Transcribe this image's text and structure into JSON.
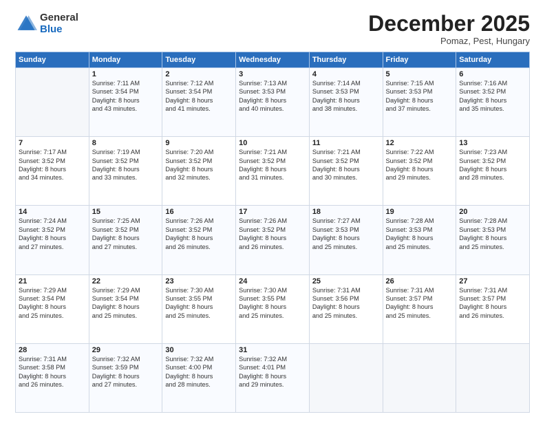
{
  "logo": {
    "general": "General",
    "blue": "Blue"
  },
  "header": {
    "month": "December 2025",
    "location": "Pomaz, Pest, Hungary"
  },
  "days_of_week": [
    "Sunday",
    "Monday",
    "Tuesday",
    "Wednesday",
    "Thursday",
    "Friday",
    "Saturday"
  ],
  "weeks": [
    [
      {
        "day": "",
        "info": ""
      },
      {
        "day": "1",
        "info": "Sunrise: 7:11 AM\nSunset: 3:54 PM\nDaylight: 8 hours\nand 43 minutes."
      },
      {
        "day": "2",
        "info": "Sunrise: 7:12 AM\nSunset: 3:54 PM\nDaylight: 8 hours\nand 41 minutes."
      },
      {
        "day": "3",
        "info": "Sunrise: 7:13 AM\nSunset: 3:53 PM\nDaylight: 8 hours\nand 40 minutes."
      },
      {
        "day": "4",
        "info": "Sunrise: 7:14 AM\nSunset: 3:53 PM\nDaylight: 8 hours\nand 38 minutes."
      },
      {
        "day": "5",
        "info": "Sunrise: 7:15 AM\nSunset: 3:53 PM\nDaylight: 8 hours\nand 37 minutes."
      },
      {
        "day": "6",
        "info": "Sunrise: 7:16 AM\nSunset: 3:52 PM\nDaylight: 8 hours\nand 35 minutes."
      }
    ],
    [
      {
        "day": "7",
        "info": "Sunrise: 7:17 AM\nSunset: 3:52 PM\nDaylight: 8 hours\nand 34 minutes."
      },
      {
        "day": "8",
        "info": "Sunrise: 7:19 AM\nSunset: 3:52 PM\nDaylight: 8 hours\nand 33 minutes."
      },
      {
        "day": "9",
        "info": "Sunrise: 7:20 AM\nSunset: 3:52 PM\nDaylight: 8 hours\nand 32 minutes."
      },
      {
        "day": "10",
        "info": "Sunrise: 7:21 AM\nSunset: 3:52 PM\nDaylight: 8 hours\nand 31 minutes."
      },
      {
        "day": "11",
        "info": "Sunrise: 7:21 AM\nSunset: 3:52 PM\nDaylight: 8 hours\nand 30 minutes."
      },
      {
        "day": "12",
        "info": "Sunrise: 7:22 AM\nSunset: 3:52 PM\nDaylight: 8 hours\nand 29 minutes."
      },
      {
        "day": "13",
        "info": "Sunrise: 7:23 AM\nSunset: 3:52 PM\nDaylight: 8 hours\nand 28 minutes."
      }
    ],
    [
      {
        "day": "14",
        "info": "Sunrise: 7:24 AM\nSunset: 3:52 PM\nDaylight: 8 hours\nand 27 minutes."
      },
      {
        "day": "15",
        "info": "Sunrise: 7:25 AM\nSunset: 3:52 PM\nDaylight: 8 hours\nand 27 minutes."
      },
      {
        "day": "16",
        "info": "Sunrise: 7:26 AM\nSunset: 3:52 PM\nDaylight: 8 hours\nand 26 minutes."
      },
      {
        "day": "17",
        "info": "Sunrise: 7:26 AM\nSunset: 3:52 PM\nDaylight: 8 hours\nand 26 minutes."
      },
      {
        "day": "18",
        "info": "Sunrise: 7:27 AM\nSunset: 3:53 PM\nDaylight: 8 hours\nand 25 minutes."
      },
      {
        "day": "19",
        "info": "Sunrise: 7:28 AM\nSunset: 3:53 PM\nDaylight: 8 hours\nand 25 minutes."
      },
      {
        "day": "20",
        "info": "Sunrise: 7:28 AM\nSunset: 3:53 PM\nDaylight: 8 hours\nand 25 minutes."
      }
    ],
    [
      {
        "day": "21",
        "info": "Sunrise: 7:29 AM\nSunset: 3:54 PM\nDaylight: 8 hours\nand 25 minutes."
      },
      {
        "day": "22",
        "info": "Sunrise: 7:29 AM\nSunset: 3:54 PM\nDaylight: 8 hours\nand 25 minutes."
      },
      {
        "day": "23",
        "info": "Sunrise: 7:30 AM\nSunset: 3:55 PM\nDaylight: 8 hours\nand 25 minutes."
      },
      {
        "day": "24",
        "info": "Sunrise: 7:30 AM\nSunset: 3:55 PM\nDaylight: 8 hours\nand 25 minutes."
      },
      {
        "day": "25",
        "info": "Sunrise: 7:31 AM\nSunset: 3:56 PM\nDaylight: 8 hours\nand 25 minutes."
      },
      {
        "day": "26",
        "info": "Sunrise: 7:31 AM\nSunset: 3:57 PM\nDaylight: 8 hours\nand 25 minutes."
      },
      {
        "day": "27",
        "info": "Sunrise: 7:31 AM\nSunset: 3:57 PM\nDaylight: 8 hours\nand 26 minutes."
      }
    ],
    [
      {
        "day": "28",
        "info": "Sunrise: 7:31 AM\nSunset: 3:58 PM\nDaylight: 8 hours\nand 26 minutes."
      },
      {
        "day": "29",
        "info": "Sunrise: 7:32 AM\nSunset: 3:59 PM\nDaylight: 8 hours\nand 27 minutes."
      },
      {
        "day": "30",
        "info": "Sunrise: 7:32 AM\nSunset: 4:00 PM\nDaylight: 8 hours\nand 28 minutes."
      },
      {
        "day": "31",
        "info": "Sunrise: 7:32 AM\nSunset: 4:01 PM\nDaylight: 8 hours\nand 29 minutes."
      },
      {
        "day": "",
        "info": ""
      },
      {
        "day": "",
        "info": ""
      },
      {
        "day": "",
        "info": ""
      }
    ]
  ]
}
